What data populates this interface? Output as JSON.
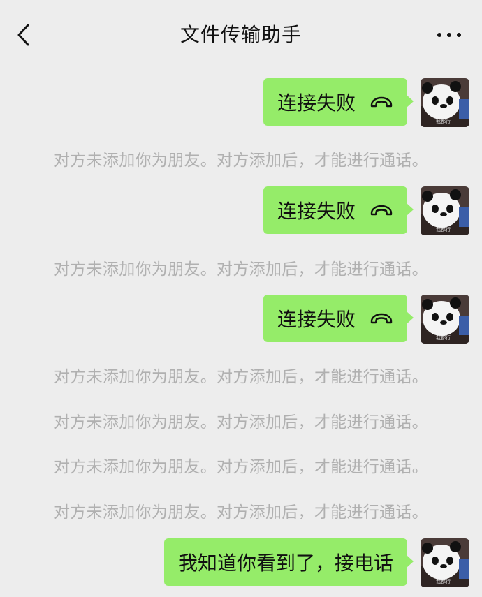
{
  "header": {
    "title": "文件传输助手",
    "back_icon": "chevron-left-icon",
    "more_icon": "more-dots-icon"
  },
  "messages": [
    {
      "type": "outgoing",
      "text": "连接失败",
      "icon": "hang-up-phone-icon"
    },
    {
      "type": "system",
      "text": "对方未添加你为朋友。对方添加后，才能进行通话。"
    },
    {
      "type": "outgoing",
      "text": "连接失败",
      "icon": "hang-up-phone-icon"
    },
    {
      "type": "system",
      "text": "对方未添加你为朋友。对方添加后，才能进行通话。"
    },
    {
      "type": "outgoing",
      "text": "连接失败",
      "icon": "hang-up-phone-icon"
    },
    {
      "type": "system",
      "text": "对方未添加你为朋友。对方添加后，才能进行通话。"
    },
    {
      "type": "system",
      "text": "对方未添加你为朋友。对方添加后，才能进行通话。"
    },
    {
      "type": "system",
      "text": "对方未添加你为朋友。对方添加后，才能进行通话。"
    },
    {
      "type": "system",
      "text": "对方未添加你为朋友。对方添加后，才能进行通话。"
    },
    {
      "type": "outgoing",
      "text": "我知道你看到了，接电话"
    }
  ],
  "avatar": {
    "label": "我都行",
    "description": "panda-avatar"
  },
  "colors": {
    "background": "#ededed",
    "bubble": "#95ec69",
    "system_text": "#b0b0b0",
    "text": "#111111"
  }
}
